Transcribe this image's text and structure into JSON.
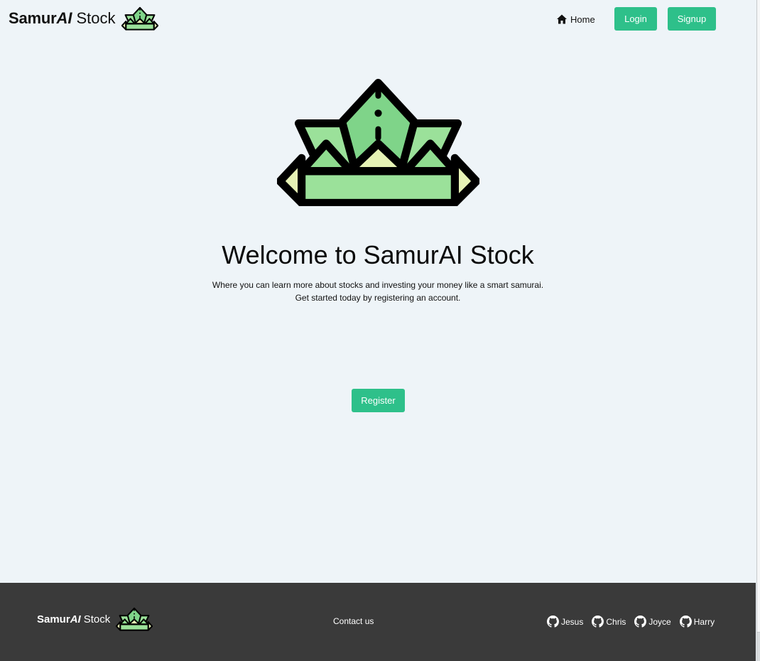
{
  "header": {
    "brand": {
      "samur": "Samur",
      "ai": "AI",
      "stock": "Stock"
    },
    "nav": {
      "home": "Home",
      "login": "Login",
      "signup": "Signup"
    }
  },
  "hero": {
    "title": "Welcome to SamurAI Stock",
    "subtitle_line1": "Where you can learn more about stocks and investing your money like a smart samurai.",
    "subtitle_line2": "Get started today by registering an account.",
    "register": "Register"
  },
  "footer": {
    "brand": {
      "samur": "Samur",
      "ai": "AI",
      "stock": "Stock"
    },
    "contact": "Contact us",
    "team": [
      {
        "name": "Jesus",
        "icon": "github-icon"
      },
      {
        "name": "Chris",
        "icon": "github-icon"
      },
      {
        "name": "Joyce",
        "icon": "github-icon"
      },
      {
        "name": "Harry",
        "icon": "github-icon"
      }
    ]
  },
  "colors": {
    "accent": "#2ec08a",
    "background": "#eef4f8",
    "footer": "#3a3a3a",
    "logo_green": "#9be19a",
    "logo_dark_green": "#7fd489",
    "logo_yellow": "#e6f2b5"
  }
}
